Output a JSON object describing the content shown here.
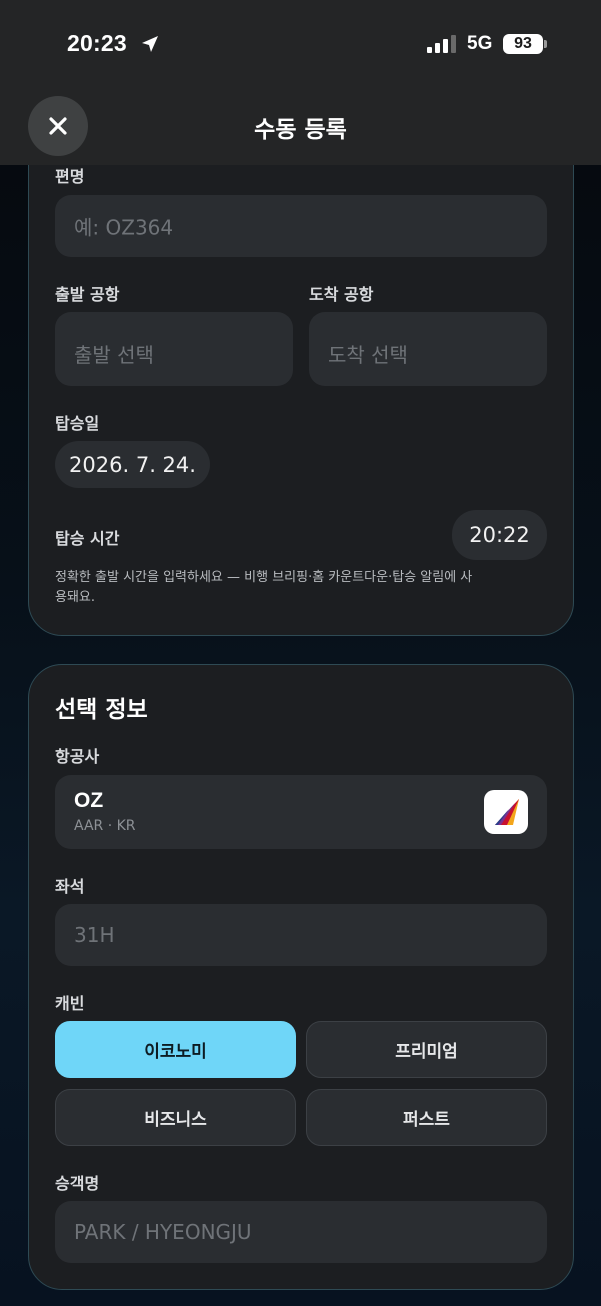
{
  "status_bar": {
    "time": "20:23",
    "network": "5G",
    "battery": "93",
    "icons": [
      "location-arrow-icon",
      "signal-bars-icon"
    ]
  },
  "header": {
    "title": "수동 등록",
    "close_icon": "close-icon"
  },
  "flight_card": {
    "flight_number": {
      "label": "편명",
      "placeholder": "예: OZ364"
    },
    "departure_airport": {
      "label": "출발 공항",
      "placeholder": "출발 선택"
    },
    "arrival_airport": {
      "label": "도착 공항",
      "placeholder": "도착 선택"
    },
    "boarding_date": {
      "label": "탑승일",
      "value": "2026. 7. 24."
    },
    "boarding_time": {
      "label": "탑승 시간",
      "value": "20:22"
    },
    "hint": "정확한 출발 시간을 입력하세요 — 비행 브리핑·홈 카운트다운·탑승 알림에 사용돼요."
  },
  "optional_card": {
    "title": "선택 정보",
    "airline": {
      "label": "항공사",
      "code": "OZ",
      "sub": "AAR · KR",
      "logo_icon": "asiana-airlines-logo"
    },
    "seat": {
      "label": "좌석",
      "placeholder": "31H"
    },
    "cabin": {
      "label": "캐빈",
      "options": [
        "이코노미",
        "프리미엄",
        "비즈니스",
        "퍼스트"
      ],
      "selected": "이코노미"
    },
    "passenger": {
      "label": "승객명",
      "placeholder": "PARK / HYEONGJU"
    }
  },
  "colors": {
    "accent": "#6fd6f8",
    "card_bg": "#1c1e21",
    "field_bg": "#2a2d31",
    "card_border": "#2e4a54"
  }
}
